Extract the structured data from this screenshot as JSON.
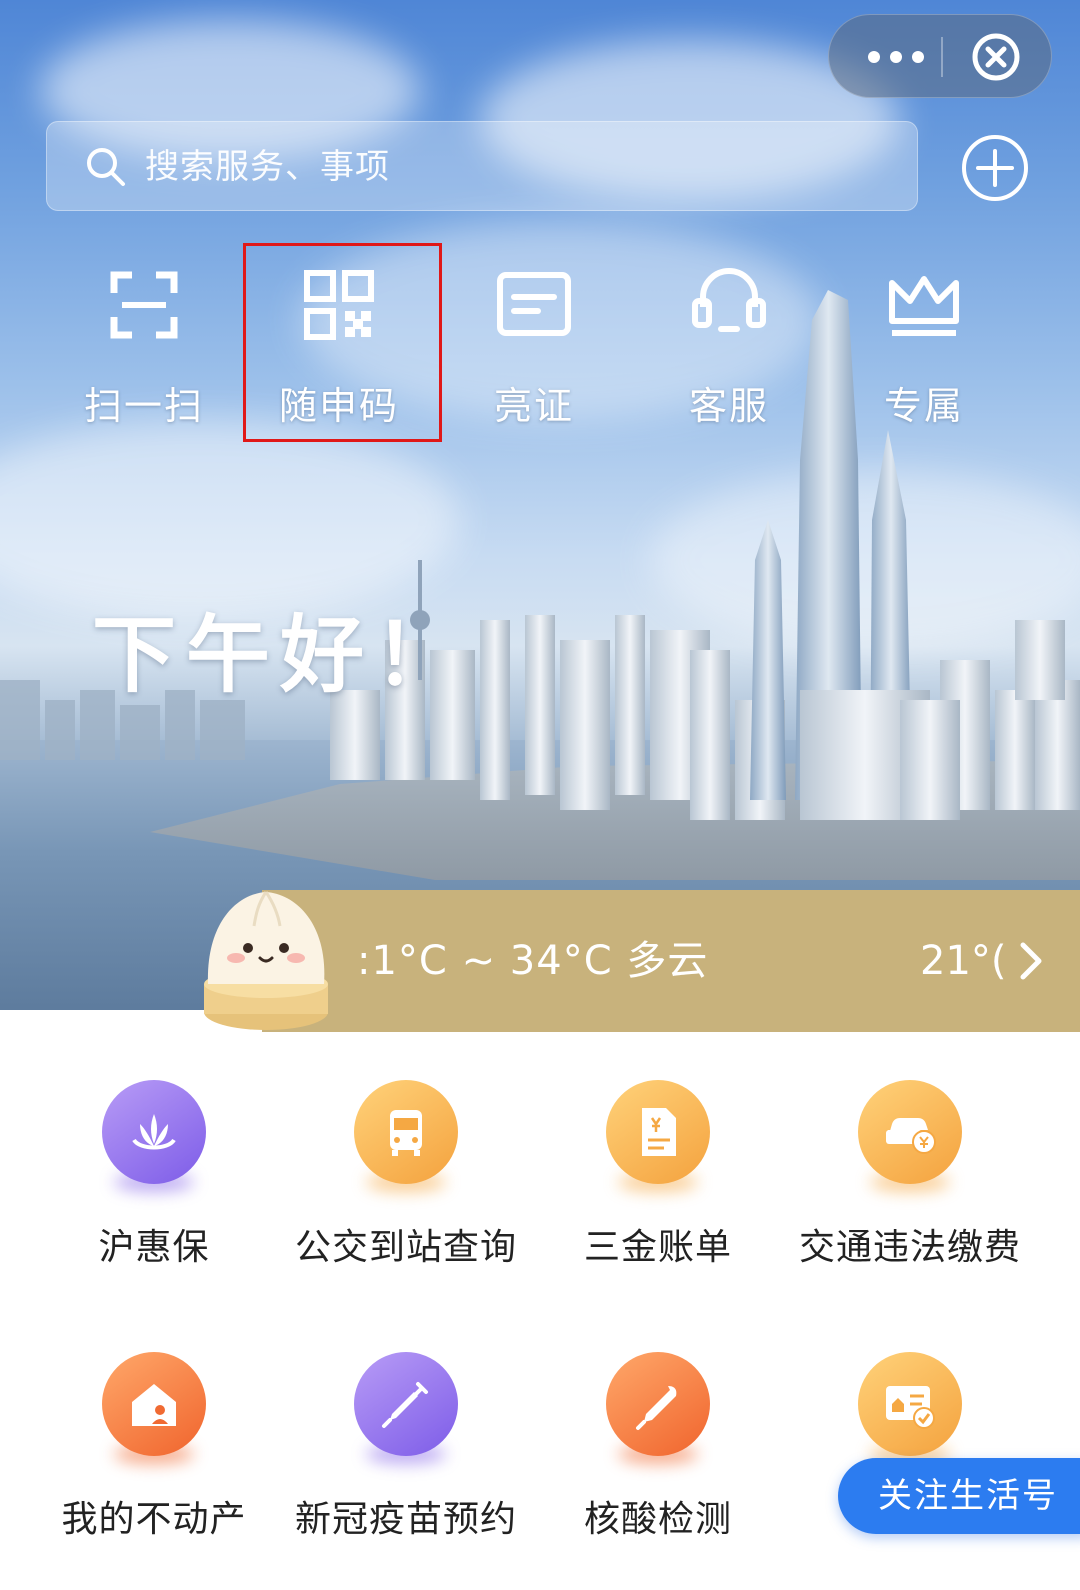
{
  "capsule": {
    "more_icon": "more-dots-icon",
    "close_icon": "close-circle-icon"
  },
  "search": {
    "placeholder": "搜索服务、事项",
    "icon": "search-icon",
    "add_icon": "plus-circle-icon"
  },
  "quick_actions": [
    {
      "label": "扫一扫",
      "icon": "scan-icon"
    },
    {
      "label": "随申码",
      "icon": "qr-code-icon",
      "highlighted": true
    },
    {
      "label": "亮证",
      "icon": "id-card-icon"
    },
    {
      "label": "客服",
      "icon": "headset-icon"
    },
    {
      "label": "专属",
      "icon": "crown-icon"
    }
  ],
  "greeting": "下午好！",
  "weather": {
    "range": ":1°C ~ 34°C 多云",
    "current": "21°(",
    "mascot": "xiaolongbao-mascot"
  },
  "services": [
    {
      "label": "沪惠保",
      "icon": "lotus-icon",
      "color": "#8a6ae9"
    },
    {
      "label": "公交到站查询",
      "icon": "bus-icon",
      "color": "#f5a843"
    },
    {
      "label": "三金账单",
      "icon": "bill-icon",
      "color": "#f5a843"
    },
    {
      "label": "交通违法缴费",
      "icon": "car-fine-icon",
      "color": "#f5a843"
    },
    {
      "label": "我的不动产",
      "icon": "house-icon",
      "color": "#f06a32"
    },
    {
      "label": "新冠疫苗预约",
      "icon": "syringe-icon",
      "color": "#8a6ae9"
    },
    {
      "label": "核酸检测",
      "icon": "test-swab-icon",
      "color": "#f06a32"
    },
    {
      "label": "",
      "icon": "residence-card-icon",
      "color": "#f5a843"
    }
  ],
  "follow_button": "关注生活号",
  "colors": {
    "accent": "#2c7cf0",
    "highlight_border": "#e01818",
    "weather_bar": "#c8b27c"
  }
}
